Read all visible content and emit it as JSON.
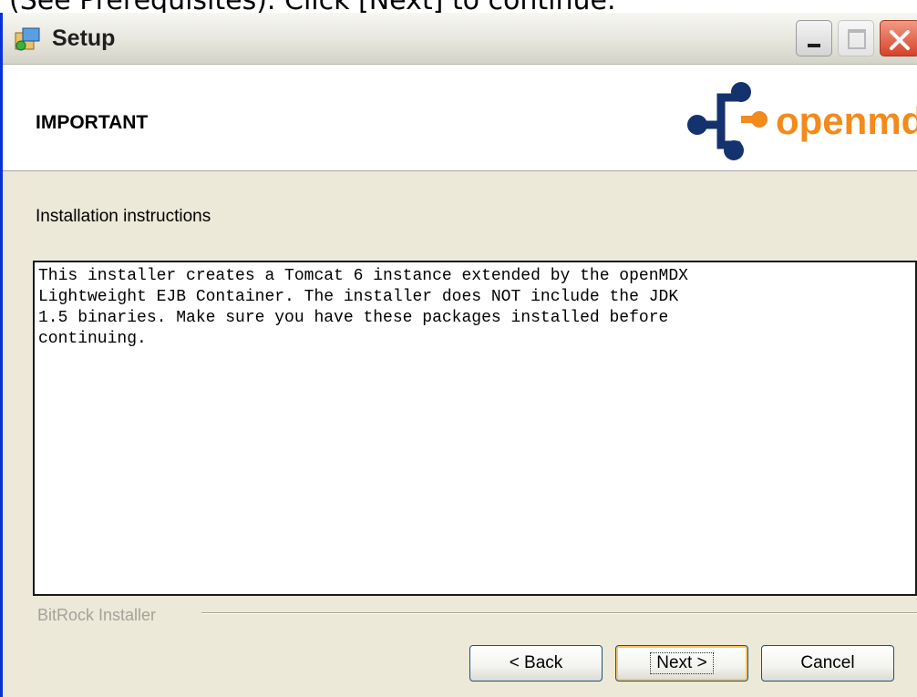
{
  "caption": "(See Prerequisites). Click [Next] to continue.",
  "window": {
    "title": "Setup",
    "header_title": "IMPORTANT",
    "logo_text": "openmdx",
    "section_label": "Installation instructions",
    "instructions": "This installer creates a Tomcat 6 instance extended by the openMDX\nLightweight EJB Container. The installer does NOT include the JDK\n1.5 binaries. Make sure you have these packages installed before\ncontinuing.",
    "brand_label": "BitRock Installer",
    "buttons": {
      "back": "< Back",
      "next": "Next >",
      "cancel": "Cancel"
    }
  },
  "colors": {
    "logo_blue": "#14326e",
    "logo_orange": "#f28a1c",
    "window_border": "#0831d9",
    "close_button": "#d6432a"
  },
  "icons": {
    "title": "setup-app-icon",
    "minimize": "minimize-icon",
    "maximize": "maximize-icon",
    "close": "close-icon"
  }
}
